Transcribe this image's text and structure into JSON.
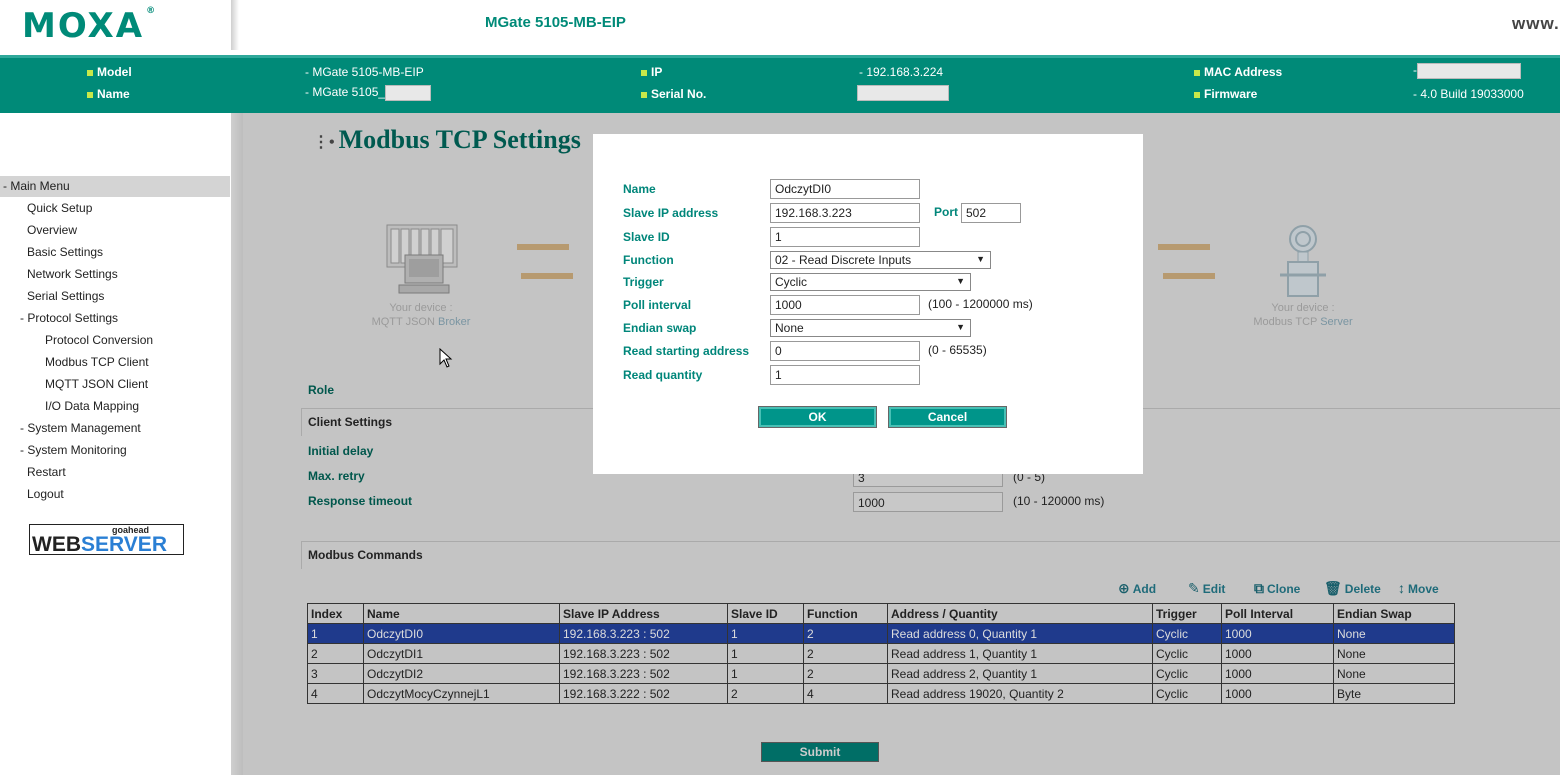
{
  "header": {
    "logo": "MOXA",
    "logo_reg": "®",
    "device_title": "MGate 5105-MB-EIP",
    "www": "www."
  },
  "info": {
    "model_label": "Model",
    "model_value": "- MGate 5105-MB-EIP",
    "name_label": "Name",
    "name_value": "- MGate 5105_",
    "ip_label": "IP",
    "ip_value": "- 192.168.3.224",
    "serial_label": "Serial No.",
    "mac_label": "MAC Address",
    "mac_value": "-",
    "firmware_label": "Firmware",
    "firmware_value": "- 4.0 Build 19033000"
  },
  "sidebar": {
    "head": "- Main Menu",
    "items": [
      {
        "label": "Quick Setup"
      },
      {
        "label": "Overview"
      },
      {
        "label": "Basic Settings"
      },
      {
        "label": "Network Settings"
      },
      {
        "label": "Serial Settings"
      },
      {
        "label": "- Protocol Settings"
      },
      {
        "label": "Protocol Conversion"
      },
      {
        "label": "Modbus TCP Client"
      },
      {
        "label": "MQTT JSON Client"
      },
      {
        "label": "I/O Data Mapping"
      },
      {
        "label": "- System Management"
      },
      {
        "label": "- System Monitoring"
      },
      {
        "label": "Restart"
      },
      {
        "label": "Logout"
      }
    ],
    "badge_top": "goahead",
    "badge_web": "WEB",
    "badge_server": "SERVER"
  },
  "main": {
    "title": "Modbus TCP Settings",
    "left_device_line1": "Your device :",
    "left_device_line2": "MQTT JSON",
    "left_device_role": "Broker",
    "right_device_line1": "Your device :",
    "right_device_line2": "Modbus TCP",
    "right_device_role": "Server",
    "role_label": "Role",
    "client_settings": "Client Settings",
    "initial_delay_label": "Initial delay",
    "max_retry_label": "Max. retry",
    "max_retry_value": "3",
    "max_retry_range": "(0 - 5)",
    "response_timeout_label": "Response timeout",
    "response_timeout_value": "1000",
    "response_timeout_range": "(10 - 120000 ms)",
    "modbus_commands": "Modbus Commands",
    "toolbar": {
      "add": "Add",
      "edit": "Edit",
      "clone": "Clone",
      "delete": "Delete",
      "move": "Move"
    },
    "table": {
      "columns": [
        "Index",
        "Name",
        "Slave IP Address",
        "Slave ID",
        "Function",
        "Address / Quantity",
        "Trigger",
        "Poll Interval",
        "Endian Swap"
      ],
      "rows": [
        [
          "1",
          "OdczytDI0",
          "192.168.3.223 : 502",
          "1",
          "2",
          "Read address 0, Quantity 1",
          "Cyclic",
          "1000",
          "None"
        ],
        [
          "2",
          "OdczytDI1",
          "192.168.3.223 : 502",
          "1",
          "2",
          "Read address 1, Quantity 1",
          "Cyclic",
          "1000",
          "None"
        ],
        [
          "3",
          "OdczytDI2",
          "192.168.3.223 : 502",
          "1",
          "2",
          "Read address 2, Quantity 1",
          "Cyclic",
          "1000",
          "None"
        ],
        [
          "4",
          "OdczytMocyCzynnejL1",
          "192.168.3.222 : 502",
          "2",
          "4",
          "Read address 19020, Quantity 2",
          "Cyclic",
          "1000",
          "Byte"
        ]
      ]
    },
    "submit": "Submit"
  },
  "modal": {
    "name_label": "Name",
    "name_value": "OdczytDI0",
    "slave_ip_label": "Slave IP address",
    "slave_ip_value": "192.168.3.223",
    "port_label": "Port",
    "port_value": "502",
    "slave_id_label": "Slave ID",
    "slave_id_value": "1",
    "function_label": "Function",
    "function_value": "02 - Read Discrete Inputs",
    "trigger_label": "Trigger",
    "trigger_value": "Cyclic",
    "poll_interval_label": "Poll interval",
    "poll_interval_value": "1000",
    "poll_interval_range": "(100 - 1200000 ms)",
    "endian_label": "Endian swap",
    "endian_value": "None",
    "read_start_label": "Read starting address",
    "read_start_value": "0",
    "read_start_range": "(0 - 65535)",
    "read_qty_label": "Read quantity",
    "read_qty_value": "1",
    "ok": "OK",
    "cancel": "Cancel"
  },
  "colors": {
    "brand_green": "#008a78",
    "label_teal": "#00867a",
    "selected_row": "#1f3a8c"
  }
}
